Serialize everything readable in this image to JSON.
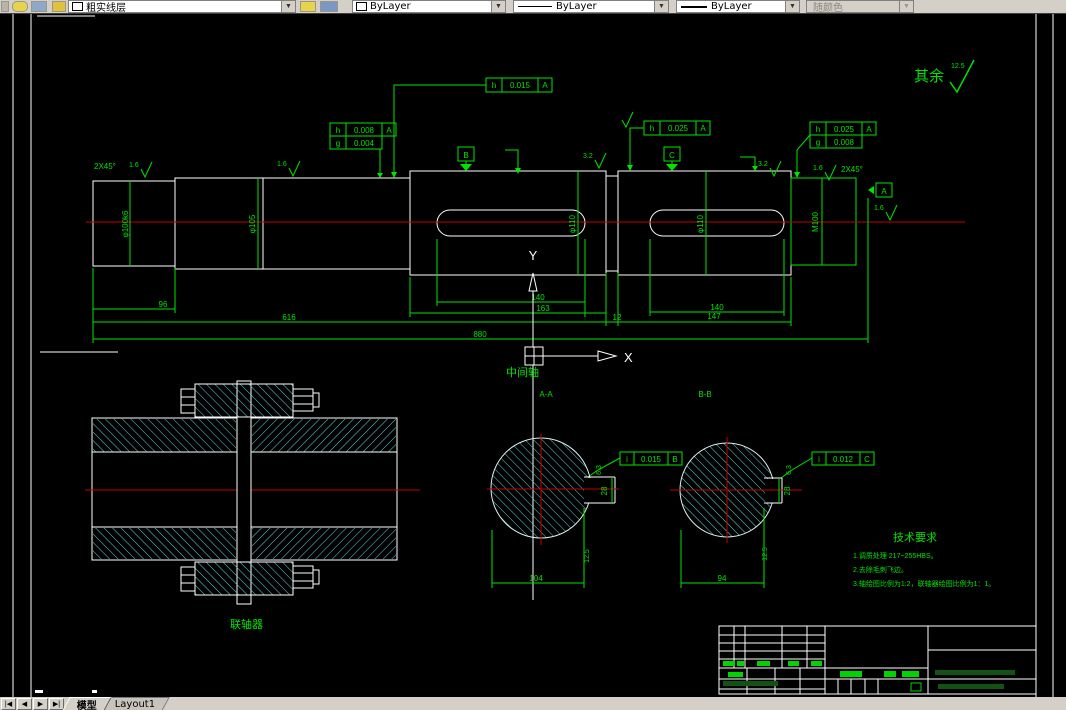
{
  "toolbar": {
    "layer_combo": {
      "value": "粗实线层"
    },
    "color_combo": {
      "value": "ByLayer"
    },
    "linetype_combo": {
      "value": "ByLayer"
    },
    "lineweight_combo": {
      "value": "ByLayer"
    },
    "plotstyle_combo": {
      "value": "随颜色"
    }
  },
  "tabbar": {
    "nav_first": "|◀",
    "nav_prev": "◀",
    "nav_next": "▶",
    "nav_last": "▶|",
    "tab_model": "模型",
    "tab_layout": "Layout1"
  },
  "drawing": {
    "colors": {
      "line": "#FFFFFF",
      "dim": "#00E300",
      "center": "#C00000",
      "hatch": "#63D6D6"
    },
    "labels": {
      "surplus": "其余",
      "surplus_value": "12.5",
      "part": "中间轴",
      "coupling": "联轴器",
      "section_a": "A-A",
      "section_b": "B-B",
      "ucs_x": "X",
      "ucs_y": "Y",
      "chamfer_left": "2X45°",
      "chamfer_right": "2X45°"
    },
    "tech": {
      "title": "技术要求",
      "line1": "1.调质处理 217~255HBS。",
      "line2": "2.去除毛刺飞边。",
      "line3": "3.轴绘图比例为1:2，联轴器绘图比例为1：1。"
    },
    "dims": {
      "len1": "96",
      "len2": "616",
      "len3": "880",
      "key1_len": "140",
      "key1_seg": "163",
      "groove": "12",
      "key2_len": "140",
      "key2_seg": "147",
      "sec_a_width": "104",
      "sec_b_width": "94",
      "key_w_a": "28",
      "key_w_b": "28",
      "dia1": "φ100k6",
      "dia2": "φ105",
      "dia3": "φ110",
      "dia4": "φ110",
      "dia5": "M100",
      "r16": "1.6",
      "r32": "3.2",
      "r63": "6.3",
      "r125": "12.5"
    },
    "frames": {
      "f1_sym1": "h",
      "f1_val1": "0.008",
      "f1_ref1": "A",
      "f1_sym2": "g",
      "f1_val2": "0.004",
      "f2_sym": "h",
      "f2_val": "0.015",
      "f2_ref": "A",
      "f3_sym": "h",
      "f3_val": "0.025",
      "f3_ref": "A",
      "f4_sym1": "h",
      "f4_val1": "0.025",
      "f4_ref1": "A",
      "f4_sym2": "g",
      "f4_val2": "0.008",
      "f5_sym": "i",
      "f5_val": "0.015",
      "f5_ref": "B",
      "f6_sym": "i",
      "f6_val": "0.012",
      "f6_ref": "C"
    },
    "datums": {
      "a": "A",
      "b": "B",
      "c": "C"
    }
  }
}
